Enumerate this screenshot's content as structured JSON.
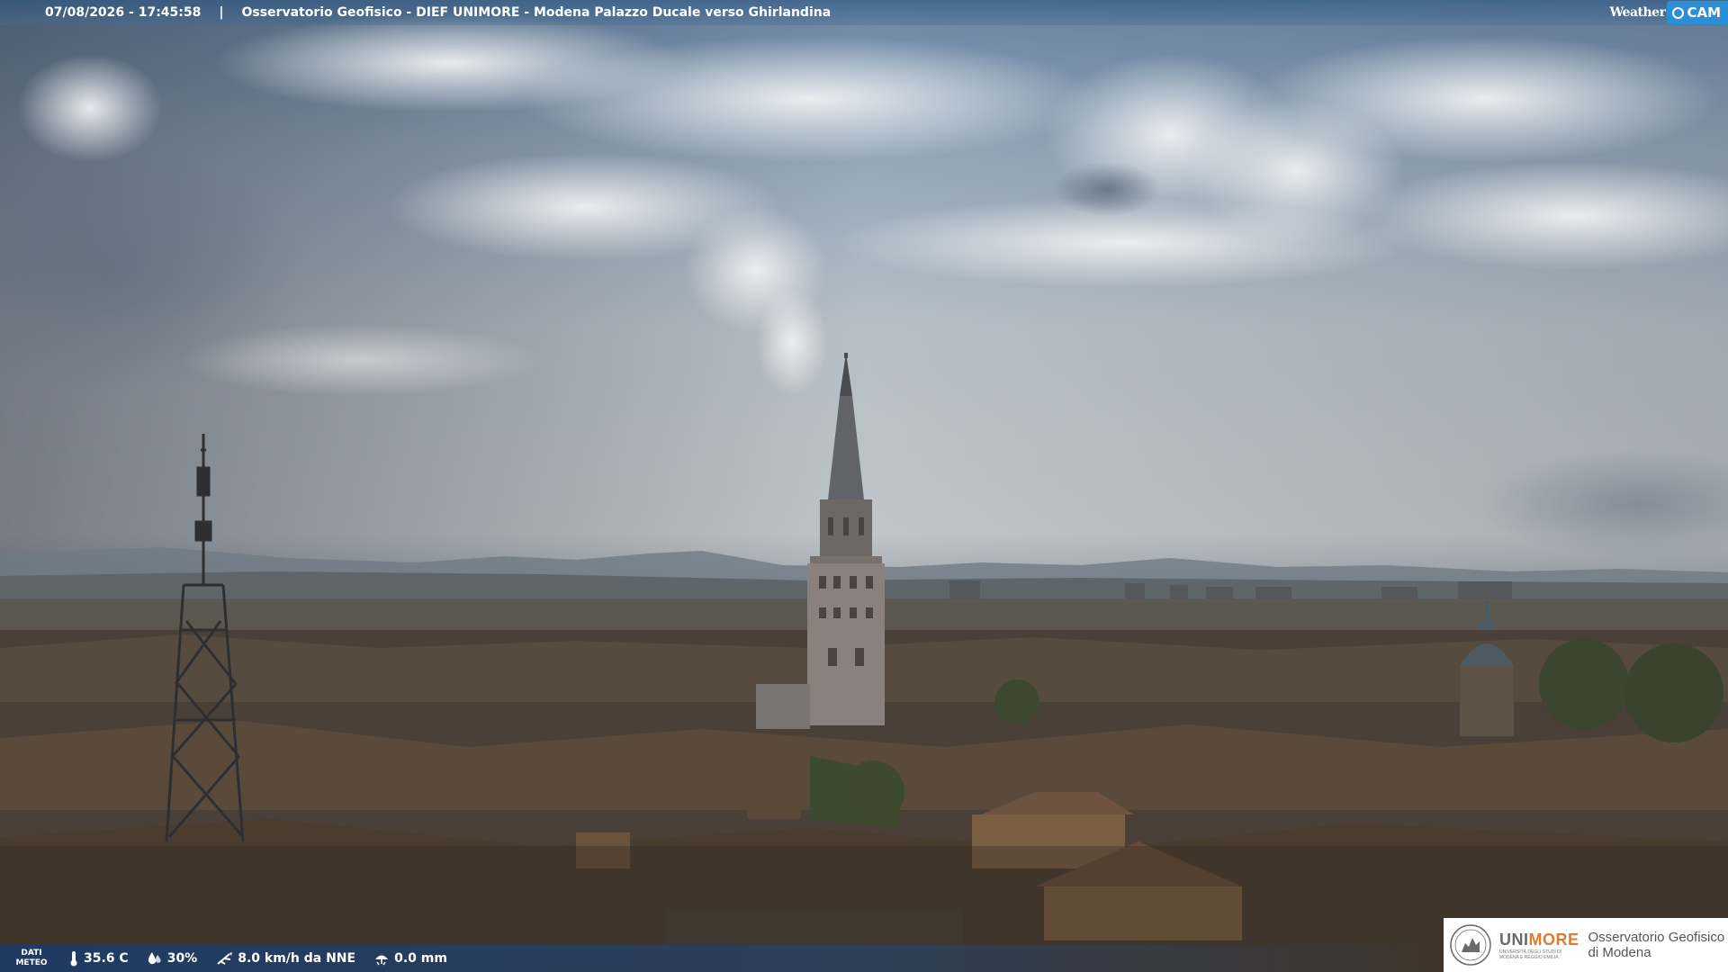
{
  "overlay": {
    "timestamp": "07/08/2026 - 17:45:58",
    "separator": "|",
    "caption": "Osservatorio Geofisico - DIEF UNIMORE - Modena Palazzo Ducale verso Ghirlandina"
  },
  "brand": {
    "weather": "Weather",
    "cam": "CAM"
  },
  "meteo": {
    "label_line1": "DATI",
    "label_line2": "METEO",
    "temperature": "35.6 C",
    "humidity": "30%",
    "wind": "8.0 km/h da NNE",
    "rain": "0.0 mm"
  },
  "unimore": {
    "name_uni": "UNI",
    "name_more": "MORE",
    "subline": "UNIVERSITÀ DEGLI STUDI DI MODENA E REGGIO EMILIA",
    "observatory_line1": "Osservatorio Geofisico",
    "observatory_line2": "di Modena"
  },
  "colors": {
    "overlay_bar": "#2f5f92",
    "brand_blue": "#2a8fd8",
    "unimore_orange": "#e07b2a",
    "unimore_gray": "#6a6a6a"
  },
  "icons": [
    "thermometer-icon",
    "humidity-icon",
    "wind-icon",
    "rain-icon",
    "weathercam-logo-icon",
    "unimore-seal-icon"
  ]
}
